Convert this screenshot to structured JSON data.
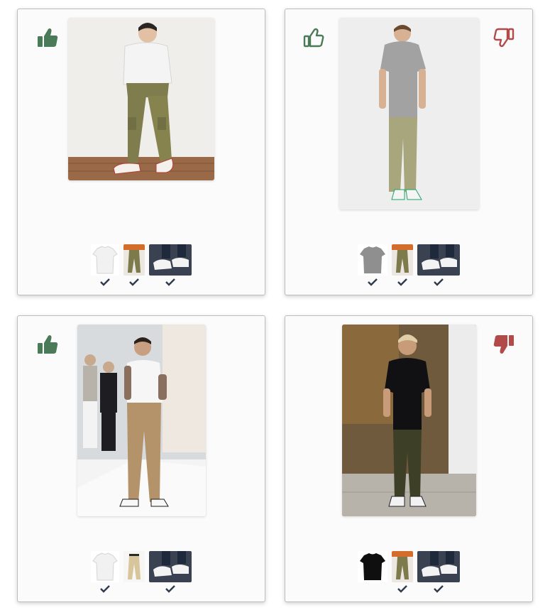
{
  "cards": [
    {
      "like": {
        "icon": "thumbs-up-filled-icon",
        "color": "#4a7a58"
      },
      "dislike": null,
      "photo": "outfit-photo-white-tee-olive-cargo",
      "items": [
        {
          "icon": "white-tshirt-thumbnail",
          "selected": true
        },
        {
          "icon": "olive-cargo-pants-thumbnail",
          "selected": true
        },
        {
          "icon": "white-sneakers-thumbnail",
          "selected": true
        }
      ]
    },
    {
      "like": {
        "icon": "thumbs-up-outline-icon",
        "color": "#4a7a58"
      },
      "dislike": {
        "icon": "thumbs-down-outline-icon",
        "color": "#b24a4a"
      },
      "photo": "outfit-photo-grey-tee-khaki-pants",
      "items": [
        {
          "icon": "grey-tshirt-thumbnail",
          "selected": true
        },
        {
          "icon": "olive-cargo-pants-thumbnail",
          "selected": true
        },
        {
          "icon": "white-sneakers-thumbnail",
          "selected": true
        }
      ]
    },
    {
      "like": {
        "icon": "thumbs-up-filled-icon",
        "color": "#4a7a58"
      },
      "dislike": null,
      "photo": "outfit-photo-white-tee-tan-trousers",
      "items": [
        {
          "icon": "white-tshirt-thumbnail",
          "selected": true
        },
        {
          "icon": "beige-trousers-thumbnail",
          "selected": false
        },
        {
          "icon": "white-sneakers-thumbnail",
          "selected": true
        }
      ]
    },
    {
      "like": null,
      "dislike": {
        "icon": "thumbs-down-filled-icon",
        "color": "#b24a4a"
      },
      "photo": "outfit-photo-black-tee-olive-cargo",
      "items": [
        {
          "icon": "black-tshirt-thumbnail",
          "selected": false
        },
        {
          "icon": "olive-cargo-pants-thumbnail",
          "selected": true
        },
        {
          "icon": "white-sneakers-thumbnail",
          "selected": true
        }
      ]
    }
  ]
}
